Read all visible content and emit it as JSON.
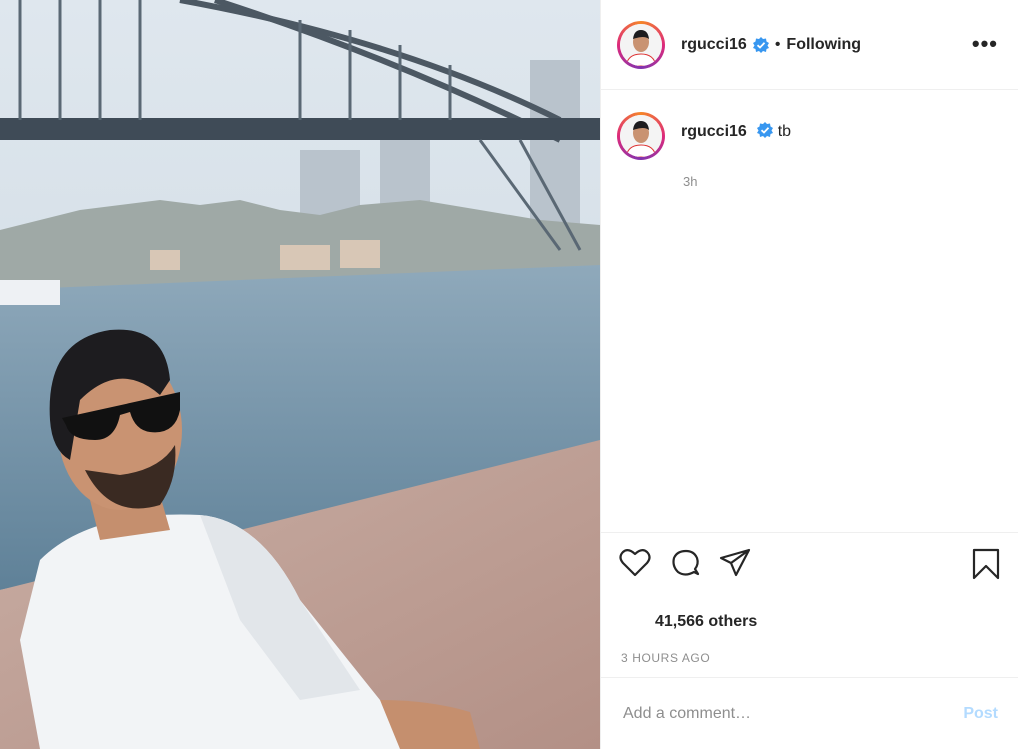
{
  "photo": {
    "alt": "photo"
  },
  "header": {
    "username": "rgucci16",
    "separator": "•",
    "follow_label": "Following",
    "more_label": "•••"
  },
  "caption": {
    "username": "rgucci16",
    "text": "tb",
    "time": "3h"
  },
  "actions": {
    "like_icon": "heart-icon",
    "comment_icon": "comment-icon",
    "share_icon": "share-icon",
    "save_icon": "bookmark-icon"
  },
  "likes": {
    "text": "41,566 others"
  },
  "posted": {
    "text": "3 HOURS AGO"
  },
  "comment_box": {
    "placeholder": "Add a comment…",
    "post_label": "Post"
  },
  "colors": {
    "verified": "#3897f0",
    "post_disabled": "#b3dbff",
    "muted": "#8e8e8e"
  }
}
